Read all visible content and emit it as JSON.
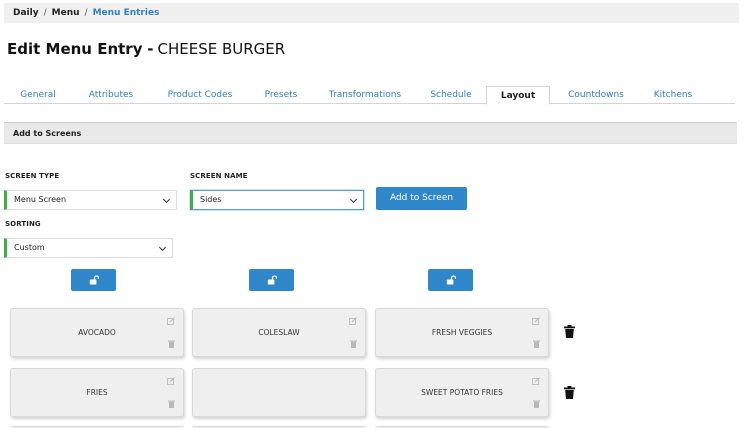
{
  "breadcrumb": {
    "items": [
      "Daily",
      "Menu"
    ],
    "current": "Menu Entries",
    "separator": "/"
  },
  "title": {
    "prefix": "Edit Menu Entry",
    "dash": "-",
    "name": "CHEESE BURGER"
  },
  "tabs": [
    {
      "label": "General"
    },
    {
      "label": "Attributes"
    },
    {
      "label": "Product Codes"
    },
    {
      "label": "Presets"
    },
    {
      "label": "Transformations"
    },
    {
      "label": "Schedule"
    },
    {
      "label": "Layout",
      "active": true
    },
    {
      "label": "Countdowns"
    },
    {
      "label": "Kitchens"
    }
  ],
  "section": {
    "title": "Add to Screens"
  },
  "form": {
    "screen_type": {
      "label": "SCREEN TYPE",
      "value": "Menu Screen"
    },
    "screen_name": {
      "label": "SCREEN NAME",
      "value": "Sides"
    },
    "sorting": {
      "label": "SORTING",
      "value": "Custom"
    },
    "add_button": "Add to Screen"
  },
  "grid": {
    "rows": [
      [
        "AVOCADO",
        "COLESLAW",
        "FRESH VEGGIES"
      ],
      [
        "FRIES",
        "",
        "SWEET POTATO FRIES"
      ]
    ]
  },
  "icons": {
    "lock": "unlock-icon",
    "edit": "edit-icon",
    "trash": "trash-icon",
    "dropdown": "chevron-down-icon"
  },
  "colors": {
    "accent": "#2f86c9",
    "link": "#2f7fc4",
    "valid": "#3fae4a"
  }
}
